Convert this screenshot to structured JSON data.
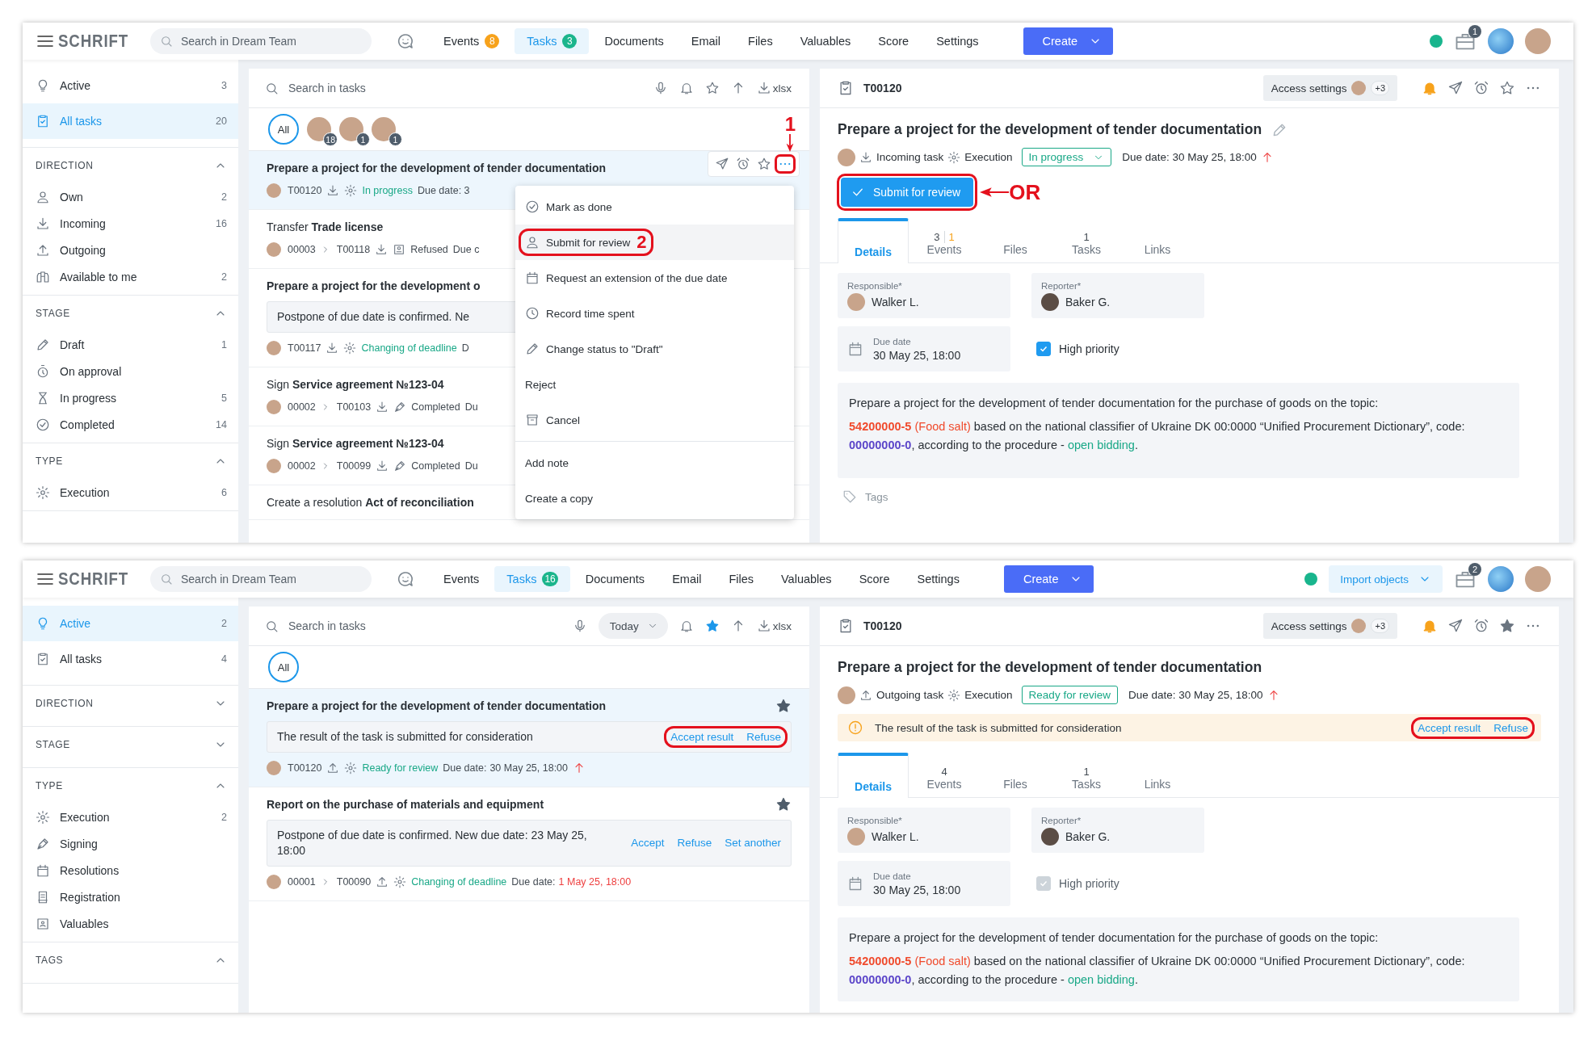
{
  "screens": [
    {
      "header": {
        "logo": "SCHRIFT",
        "search_placeholder": "Search in Dream Team",
        "nav": [
          {
            "label": "Events",
            "badge": "8",
            "color": "#f7a21b",
            "selected": false
          },
          {
            "label": "Tasks",
            "badge": "3",
            "color": "#1bb58c",
            "selected": true
          },
          {
            "label": "Documents",
            "selected": false
          },
          {
            "label": "Email",
            "selected": false
          },
          {
            "label": "Files",
            "selected": false
          },
          {
            "label": "Valuables",
            "selected": false
          },
          {
            "label": "Score",
            "selected": false
          },
          {
            "label": "Settings",
            "selected": false
          }
        ],
        "create": "Create",
        "briefcase_badge": "1"
      },
      "sidebar": {
        "items": [
          {
            "kind": "active",
            "label": "Active",
            "count": "3",
            "selected": false
          },
          {
            "kind": "all",
            "label": "All tasks",
            "count": "20",
            "selected": true
          }
        ],
        "sections": [
          {
            "title": "DIRECTION",
            "expanded": true,
            "items": [
              {
                "kind": "own",
                "label": "Own",
                "count": "2"
              },
              {
                "kind": "incoming",
                "label": "Incoming",
                "count": "16"
              },
              {
                "kind": "outgoing",
                "label": "Outgoing"
              },
              {
                "kind": "available",
                "label": "Available to me",
                "count": "2"
              }
            ]
          },
          {
            "title": "STAGE",
            "expanded": true,
            "items": [
              {
                "kind": "draft",
                "label": "Draft",
                "count": "1"
              },
              {
                "kind": "approval",
                "label": "On approval"
              },
              {
                "kind": "progress",
                "label": "In progress",
                "count": "5"
              },
              {
                "kind": "completed",
                "label": "Completed",
                "count": "14"
              }
            ]
          },
          {
            "title": "TYPE",
            "expanded": true,
            "items": [
              {
                "kind": "execution",
                "label": "Execution",
                "count": "6"
              }
            ]
          }
        ]
      },
      "list": {
        "search_placeholder": "Search in tasks",
        "favorites_only": false,
        "export": "xlsx",
        "all_label": "All",
        "avatars": [
          {
            "count": "18"
          },
          {
            "count": "1"
          },
          {
            "count": "1"
          }
        ],
        "tasks": [
          {
            "title": "Prepare a project for the development of tender documentation",
            "unread": true,
            "selected": true,
            "toolbar": {
              "highlighted": true,
              "annotation": "1"
            },
            "meta": {
              "id": "T00120",
              "incoming": true,
              "kind": "execution",
              "status": "In progress",
              "status_active": true,
              "due_label": "Due date: 3"
            }
          },
          {
            "title": "Transfer **Trade license**",
            "unread": false,
            "selected": false,
            "meta": {
              "parent": "00003",
              "id": "T00118",
              "incoming": true,
              "kind": "refusal",
              "status": "Refused",
              "status_active": false,
              "due_label": "Due c"
            }
          },
          {
            "title": "Prepare a project for the development o",
            "unread": true,
            "selected": false,
            "note": {
              "text": "Postpone of due date is confirmed. Ne"
            },
            "meta": {
              "id": "T00117",
              "incoming": true,
              "kind": "execution",
              "status": "Changing of deadline",
              "status_active": true,
              "due_label": "D"
            }
          },
          {
            "title": "Sign **Service agreement №123-04**",
            "unread": false,
            "selected": false,
            "meta": {
              "parent": "00002",
              "id": "T00103",
              "incoming": true,
              "kind": "signing",
              "status": "Completed",
              "status_active": false,
              "due_label": "Du"
            }
          },
          {
            "title": "Sign **Service agreement №123-04**",
            "unread": false,
            "selected": false,
            "meta": {
              "parent": "00002",
              "id": "T00099",
              "incoming": true,
              "kind": "signing",
              "status": "Completed",
              "status_active": false,
              "due_label": "Du"
            }
          },
          {
            "title": "Create a resolution **Act of reconciliation**",
            "unread": false,
            "selected": false
          }
        ]
      },
      "menu": {
        "groups": [
          {
            "items": [
              {
                "kind": "done",
                "label": "Mark as done",
                "highlighted": false
              },
              {
                "kind": "review",
                "label": "Submit for review",
                "highlighted": true,
                "annotation": "2"
              },
              {
                "kind": "extension",
                "label": "Request an extension of the due date",
                "highlighted": false
              },
              {
                "kind": "time",
                "label": "Record time spent",
                "highlighted": false
              },
              {
                "kind": "draft",
                "label": "Change status to \"Draft\"",
                "highlighted": false
              },
              {
                "kind": "plain",
                "label": "Reject",
                "highlighted": false
              },
              {
                "kind": "cancel",
                "label": "Cancel",
                "highlighted": false
              }
            ]
          },
          {
            "items": [
              {
                "kind": "plain",
                "label": "Add note",
                "highlighted": false
              },
              {
                "kind": "plain",
                "label": "Create a copy",
                "highlighted": false
              }
            ]
          }
        ]
      },
      "detail": {
        "id": "T00120",
        "access": "Access settings",
        "access_extra": "+3",
        "starred": false,
        "title": "Prepare a project for the development of tender documentation",
        "editable": true,
        "incoming": true,
        "direction_label": "Incoming task",
        "kind": "execution",
        "type_label": "Execution",
        "status": "In progress",
        "status_dropdown": true,
        "due": "Due date: 30 May 25, 18:00",
        "high_priority": true,
        "submit": {
          "label": "Submit for review",
          "highlighted": true,
          "annotation": "OR"
        },
        "tabs": [
          {
            "label": "Details",
            "selected": true
          },
          {
            "label": "Events",
            "count": "3",
            "extra": "1",
            "selected": false
          },
          {
            "label": "Files",
            "selected": false
          },
          {
            "label": "Tasks",
            "count": "1",
            "selected": false
          },
          {
            "label": "Links",
            "selected": false
          }
        ],
        "responsible_label": "Responsible*",
        "responsible": "Walker L.",
        "reporter_label": "Reporter*",
        "reporter": "Baker G.",
        "due_label": "Due date",
        "due_value": "30 May 25, 18:00",
        "priority": {
          "label": "High priority",
          "checked": true,
          "disabled": false
        },
        "description": [
          [
            {
              "text": "Prepare a project for the development of tender documentation for the purchase of goods on the topic:",
              "kind": "plain"
            }
          ],
          [
            {
              "text": "54200000-5",
              "kind": "code"
            },
            {
              "text": " (Food salt)",
              "kind": "note"
            },
            {
              "text": " based on the national classifier of Ukraine DK 00:0000 “Unified Procurement Dictionary”, code: ",
              "kind": "plain"
            },
            {
              "text": "00000000-0",
              "kind": "id"
            },
            {
              "text": ", according to the procedure - ",
              "kind": "plain"
            },
            {
              "text": "open bidding",
              "kind": "link"
            },
            {
              "text": ".",
              "kind": "plain"
            }
          ]
        ],
        "tags_label": "Tags"
      }
    },
    {
      "header": {
        "logo": "SCHRIFT",
        "search_placeholder": "Search in Dream Team",
        "nav": [
          {
            "label": "Events",
            "selected": false
          },
          {
            "label": "Tasks",
            "badge": "16",
            "color": "#1bb58c",
            "selected": true
          },
          {
            "label": "Documents",
            "selected": false
          },
          {
            "label": "Email",
            "selected": false
          },
          {
            "label": "Files",
            "selected": false
          },
          {
            "label": "Valuables",
            "selected": false
          },
          {
            "label": "Score",
            "selected": false
          },
          {
            "label": "Settings",
            "selected": false
          }
        ],
        "create": "Create",
        "import": "Import objects",
        "briefcase_badge": "2"
      },
      "sidebar": {
        "items": [
          {
            "kind": "active",
            "label": "Active",
            "count": "2",
            "selected": true
          },
          {
            "kind": "all",
            "label": "All tasks",
            "count": "4",
            "selected": false
          }
        ],
        "sections": [
          {
            "title": "DIRECTION",
            "expanded": false
          },
          {
            "title": "STAGE",
            "expanded": false
          },
          {
            "title": "TYPE",
            "expanded": true,
            "items": [
              {
                "kind": "execution",
                "label": "Execution",
                "count": "2"
              },
              {
                "kind": "signing",
                "label": "Signing"
              },
              {
                "kind": "resolutions",
                "label": "Resolutions"
              },
              {
                "kind": "registration",
                "label": "Registration"
              },
              {
                "kind": "valuables",
                "label": "Valuables"
              }
            ]
          },
          {
            "title": "TAGS",
            "expanded": true
          }
        ]
      },
      "list": {
        "search_placeholder": "Search in tasks",
        "period": "Today",
        "favorites_only": true,
        "export": "xlsx",
        "all_label": "All",
        "tasks": [
          {
            "title": "Prepare a project for the development of tender documentation",
            "unread": true,
            "selected": true,
            "starred": true,
            "note": {
              "text": "The result of the task is submitted for consideration",
              "highlighted": true,
              "actions": [
                "Accept result",
                "Refuse"
              ]
            },
            "meta": {
              "id": "T00120",
              "incoming": false,
              "kind": "execution",
              "status": "Ready for review",
              "status_active": true,
              "due_label": "Due date:",
              "due_value": "30 May 25, 18:00",
              "due_overdue": false,
              "high_priority": true
            }
          },
          {
            "title": "Report on the purchase of materials and equipment",
            "unread": true,
            "selected": false,
            "starred": true,
            "note": {
              "text": "Postpone of due date is confirmed. New due date: 23 May 25, 18:00",
              "highlighted": false,
              "actions": [
                "Accept",
                "Refuse",
                "Set another"
              ]
            },
            "meta": {
              "parent": "00001",
              "id": "T00090",
              "incoming": false,
              "kind": "execution",
              "status": "Changing of deadline",
              "status_active": true,
              "due_label": "Due date:",
              "due_value": "1 May 25, 18:00",
              "due_overdue": true,
              "high_priority": false
            }
          }
        ]
      },
      "detail": {
        "id": "T00120",
        "access": "Access settings",
        "access_extra": "+3",
        "starred": true,
        "title": "Prepare a project for the development of tender documentation",
        "editable": false,
        "incoming": false,
        "direction_label": "Outgoing task",
        "kind": "execution",
        "type_label": "Execution",
        "status": "Ready for review",
        "status_dropdown": false,
        "due": "Due date: 30 May 25, 18:00",
        "high_priority": true,
        "alert": {
          "text": "The result of the task is submitted for consideration",
          "highlighted": true,
          "actions": [
            "Accept result",
            "Refuse"
          ]
        },
        "tabs": [
          {
            "label": "Details",
            "selected": true
          },
          {
            "label": "Events",
            "count": "4",
            "selected": false
          },
          {
            "label": "Files",
            "selected": false
          },
          {
            "label": "Tasks",
            "count": "1",
            "selected": false
          },
          {
            "label": "Links",
            "selected": false
          }
        ],
        "responsible_label": "Responsible*",
        "responsible": "Walker L.",
        "reporter_label": "Reporter*",
        "reporter": "Baker G.",
        "due_label": "Due date",
        "due_value": "30 May 25, 18:00",
        "priority": {
          "label": "High priority",
          "checked": true,
          "disabled": true
        },
        "description": [
          [
            {
              "text": "Prepare a project for the development of tender documentation for the purchase of goods on the topic:",
              "kind": "plain"
            }
          ],
          [
            {
              "text": "54200000-5",
              "kind": "code"
            },
            {
              "text": " (Food salt)",
              "kind": "note"
            },
            {
              "text": " based on the national classifier of Ukraine DK 00:0000 “Unified Procurement Dictionary”, code: ",
              "kind": "plain"
            },
            {
              "text": "00000000-0",
              "kind": "id"
            },
            {
              "text": ", according to the procedure - ",
              "kind": "plain"
            },
            {
              "text": "open bidding",
              "kind": "link"
            },
            {
              "text": ".",
              "kind": "plain"
            }
          ]
        ]
      }
    }
  ]
}
